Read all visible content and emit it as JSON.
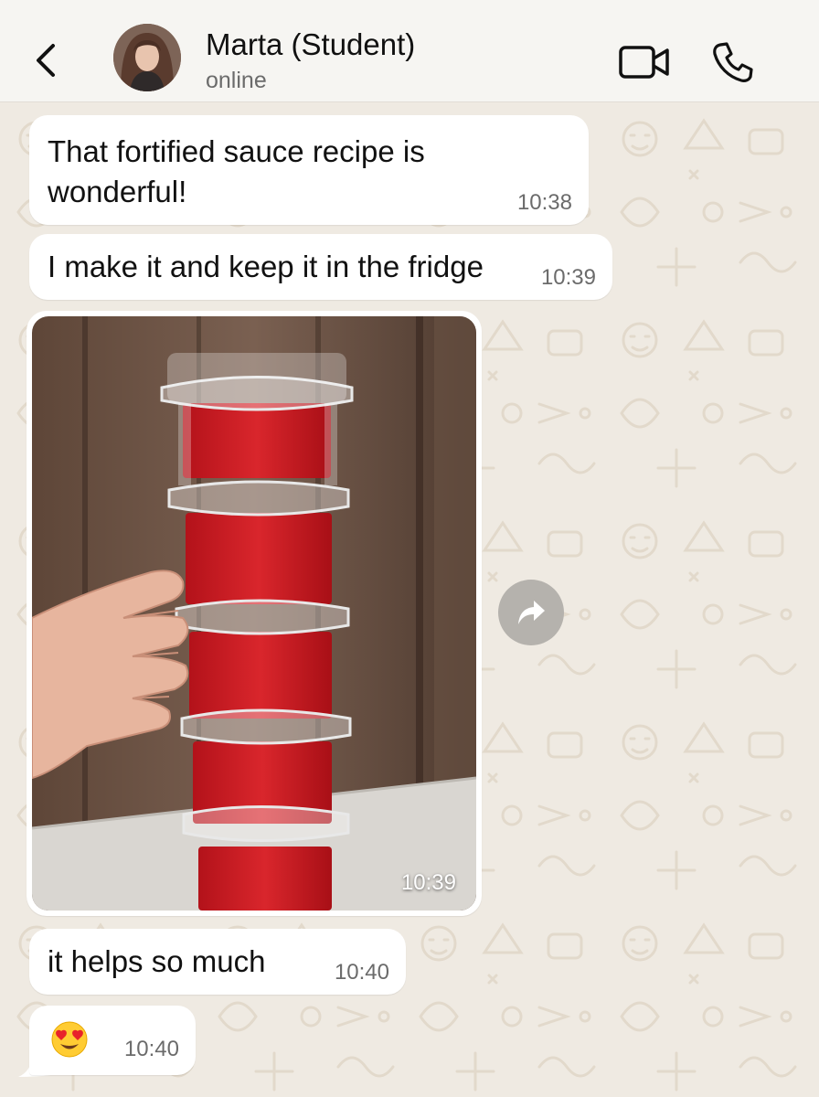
{
  "header": {
    "contact_name": "Marta (Student)",
    "status": "online",
    "back_icon": "chevron-left-icon",
    "video_icon": "video-camera-icon",
    "call_icon": "phone-icon"
  },
  "messages": [
    {
      "type": "text",
      "line1": "That fortified sauce recipe is",
      "line2": "wonderful!",
      "time": "10:38"
    },
    {
      "type": "text",
      "text": "I make it and keep it in the fridge",
      "time": "10:39"
    },
    {
      "type": "image",
      "description": "stacked containers of red sauce",
      "time": "10:39"
    },
    {
      "type": "text",
      "text": "it helps so much",
      "time": "10:40"
    },
    {
      "type": "emoji",
      "emoji": "heart-eyes-emoji",
      "time": "10:40"
    }
  ],
  "colors": {
    "bubble": "#ffffff",
    "chat_background": "#efeae2",
    "header_background": "#f6f5f2",
    "secondary_text": "#6b6b6b",
    "sauce": "#c4141c"
  }
}
